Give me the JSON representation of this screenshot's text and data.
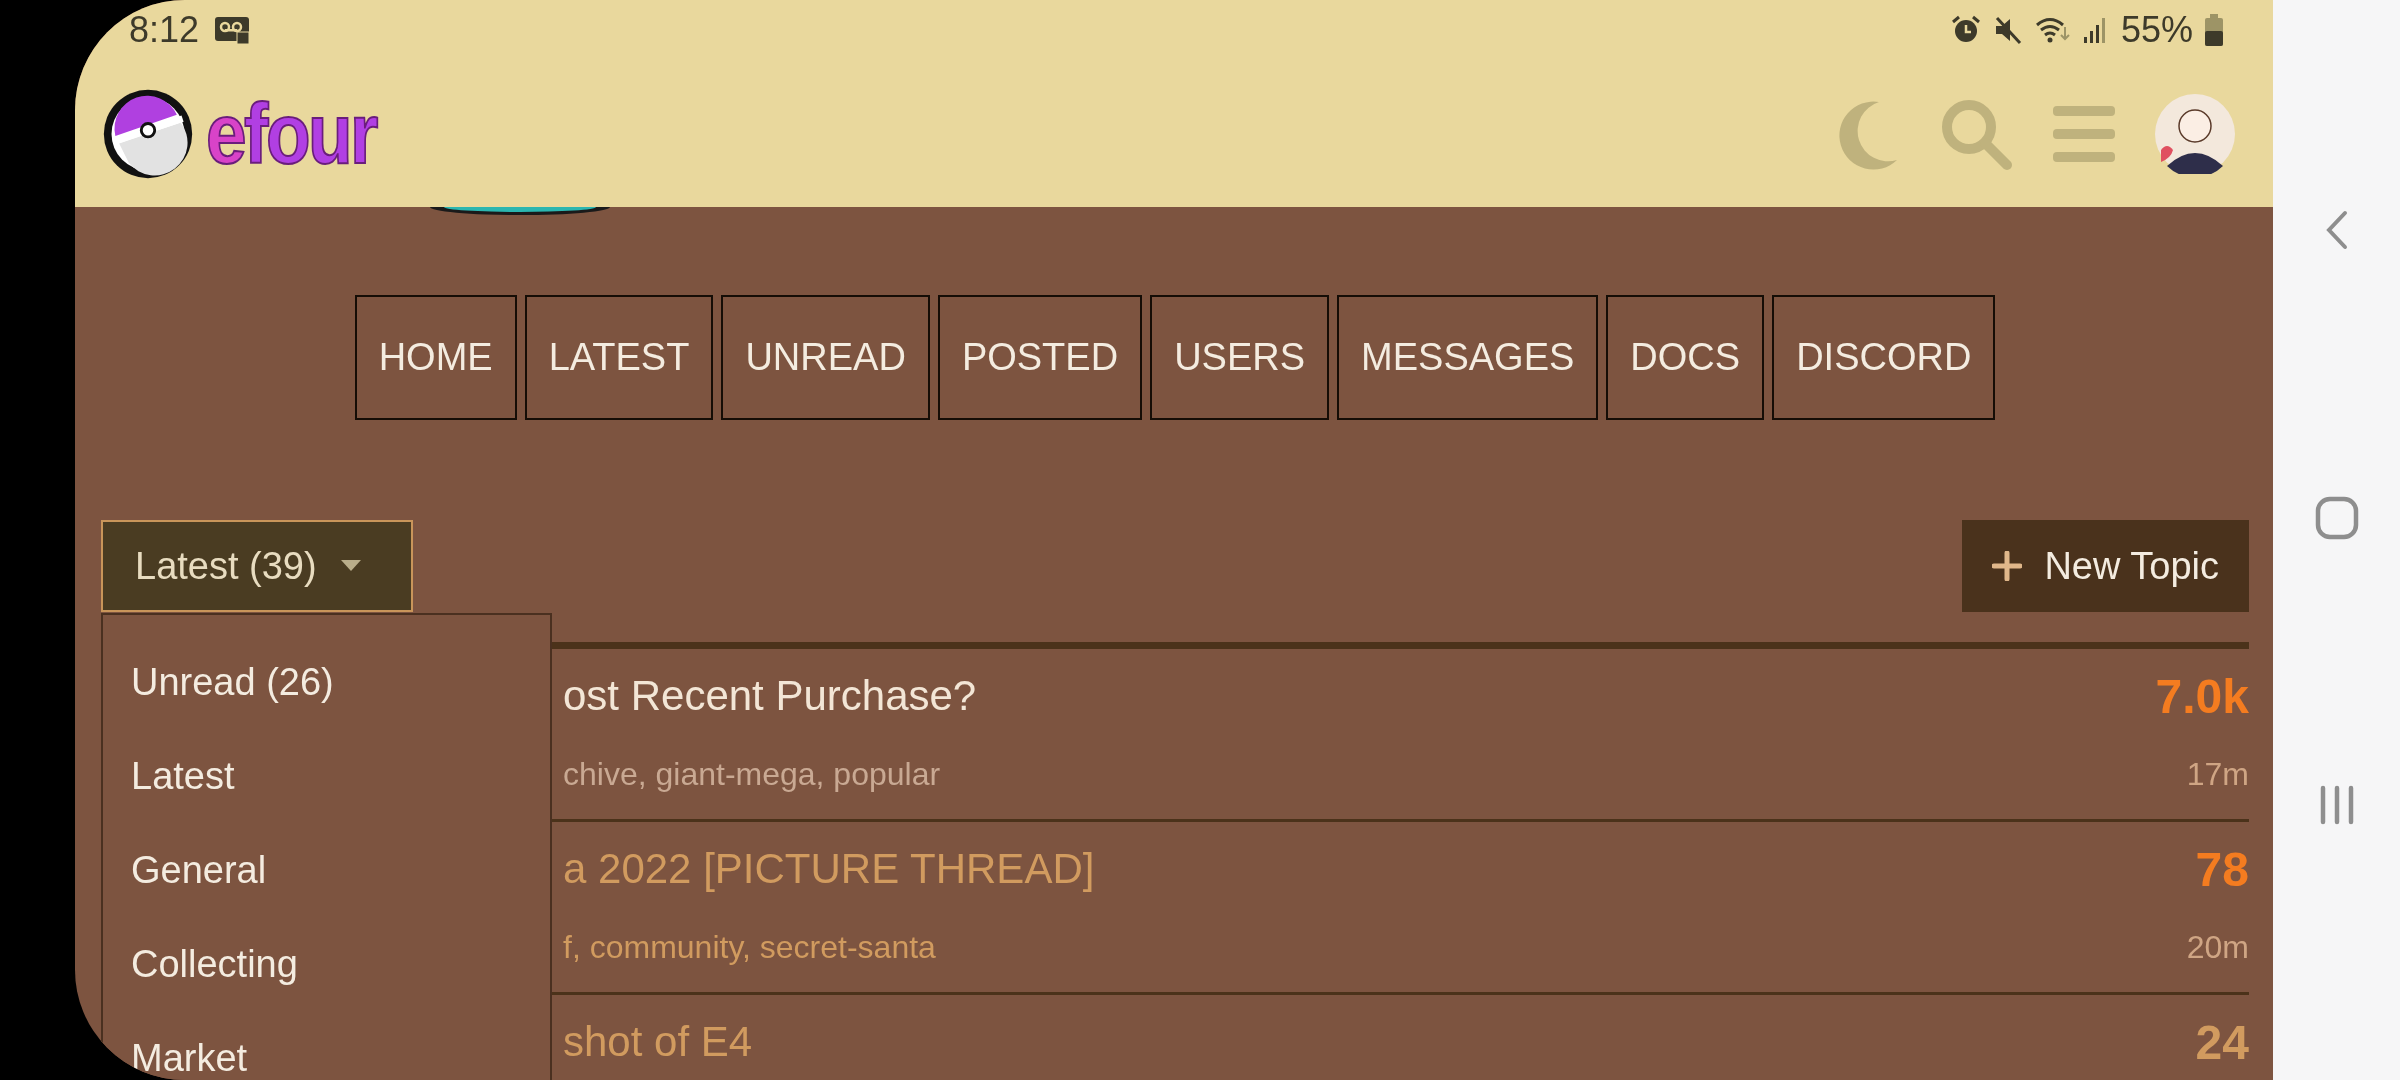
{
  "status_bar": {
    "time": "8:12",
    "battery": "55%"
  },
  "header": {
    "logo": "efour"
  },
  "nav": [
    "HOME",
    "LATEST",
    "UNREAD",
    "POSTED",
    "USERS",
    "MESSAGES",
    "DOCS",
    "DISCORD"
  ],
  "filter": {
    "label": "Latest (39)",
    "menu": [
      "Unread (26)",
      "Latest",
      "General",
      "Collecting",
      "Market"
    ]
  },
  "new_topic": "New Topic",
  "topics": [
    {
      "title": "ost Recent Purchase?",
      "tags": "chive, giant-mega, popular",
      "replies": "7.0k",
      "hot": true,
      "visited": false,
      "time": "17m"
    },
    {
      "title": "a 2022 [PICTURE THREAD]",
      "tags": "f, community, secret-santa",
      "replies": "78",
      "hot": true,
      "visited": true,
      "time": "20m"
    },
    {
      "title": "shot of E4",
      "replies": "24",
      "hot": false,
      "visited": true
    }
  ]
}
